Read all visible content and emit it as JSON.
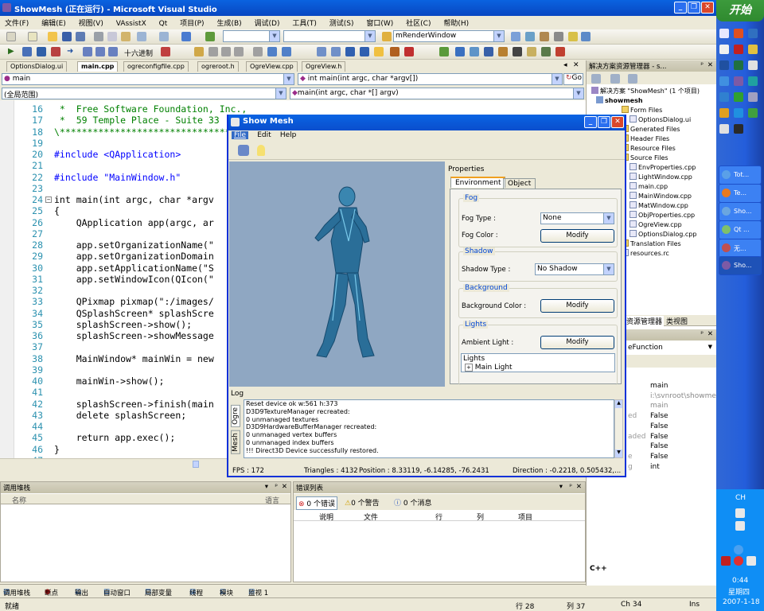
{
  "vs": {
    "title": "ShowMesh (正在运行) - Microsoft Visual Studio",
    "menu": [
      "文件(F)",
      "编辑(E)",
      "视图(V)",
      "VAssistX",
      "Qt",
      "项目(P)",
      "生成(B)",
      "调试(D)",
      "工具(T)",
      "测试(S)",
      "窗口(W)",
      "社区(C)",
      "帮助(H)"
    ],
    "toolbar2_hex_label": "十六进制",
    "target_combo": "mRenderWindow",
    "doc_tabs": [
      "OptionsDialog.ui",
      "main.cpp",
      "ogreconfigfile.cpp",
      "ogreroot.h",
      "OgreView.cpp",
      "OgreView.h"
    ],
    "scope_combo_left": "main",
    "scope_combo_right": "int main(int argc, char *argv[])",
    "go_label": "Go",
    "scope_combo_global": "(全局范围)",
    "scope_combo_func": "main(int argc, char *[] argv)"
  },
  "code": [
    {
      "ln": "16",
      "text": " *  Free Software Foundation, Inc.,",
      "cls": "cm"
    },
    {
      "ln": "17",
      "text": " *  59 Temple Place - Suite 33",
      "cls": "cm"
    },
    {
      "ln": "18",
      "text": "\\*******************************",
      "cls": "cm"
    },
    {
      "ln": "19",
      "text": "",
      "cls": ""
    },
    {
      "ln": "20",
      "text": "#include <QApplication>",
      "cls": "kw"
    },
    {
      "ln": "21",
      "text": "",
      "cls": ""
    },
    {
      "ln": "22",
      "text": "#include \"MainWindow.h\"",
      "cls": "kw"
    },
    {
      "ln": "23",
      "text": "",
      "cls": ""
    },
    {
      "ln": "24",
      "text": "int main(int argc, char *argv",
      "cls": ""
    },
    {
      "ln": "25",
      "text": "{",
      "cls": ""
    },
    {
      "ln": "26",
      "text": "    QApplication app(argc, ar",
      "cls": ""
    },
    {
      "ln": "27",
      "text": "",
      "cls": ""
    },
    {
      "ln": "28",
      "text": "    app.setOrganizationName(\"",
      "cls": ""
    },
    {
      "ln": "29",
      "text": "    app.setOrganizationDomain",
      "cls": ""
    },
    {
      "ln": "30",
      "text": "    app.setApplicationName(\"S",
      "cls": ""
    },
    {
      "ln": "31",
      "text": "    app.setWindowIcon(QIcon(\"",
      "cls": ""
    },
    {
      "ln": "32",
      "text": "",
      "cls": ""
    },
    {
      "ln": "33",
      "text": "    QPixmap pixmap(\":/images/",
      "cls": ""
    },
    {
      "ln": "34",
      "text": "    QSplashScreen* splashScre",
      "cls": ""
    },
    {
      "ln": "35",
      "text": "    splashScreen->show();",
      "cls": ""
    },
    {
      "ln": "36",
      "text": "    splashScreen->showMessage",
      "cls": ""
    },
    {
      "ln": "37",
      "text": "",
      "cls": ""
    },
    {
      "ln": "38",
      "text": "    MainWindow* mainWin = new",
      "cls": ""
    },
    {
      "ln": "39",
      "text": "",
      "cls": ""
    },
    {
      "ln": "40",
      "text": "    mainWin->show();",
      "cls": ""
    },
    {
      "ln": "41",
      "text": "",
      "cls": ""
    },
    {
      "ln": "42",
      "text": "    splashScreen->finish(main",
      "cls": ""
    },
    {
      "ln": "43",
      "text": "    delete splashScreen;",
      "cls": ""
    },
    {
      "ln": "44",
      "text": "",
      "cls": ""
    },
    {
      "ln": "45",
      "text": "    return app.exec();",
      "cls": ""
    },
    {
      "ln": "46",
      "text": "}",
      "cls": ""
    },
    {
      "ln": "47",
      "text": "",
      "cls": ""
    }
  ],
  "solution": {
    "title": "解决方案资源管理器 - s...",
    "root": "解决方案 \"ShowMesh\" (1 个项目)",
    "project": "showmesh",
    "items": [
      {
        "label": "Form Files",
        "indent": 2,
        "folder": true
      },
      {
        "label": "OptionsDialog.ui",
        "indent": 3,
        "folder": false
      },
      {
        "label": "Generated Files",
        "indent": 2,
        "folder": true
      },
      {
        "label": "Header Files",
        "indent": 2,
        "folder": true
      },
      {
        "label": "Resource Files",
        "indent": 2,
        "folder": true
      },
      {
        "label": "Source Files",
        "indent": 2,
        "folder": true
      },
      {
        "label": "EnvProperties.cpp",
        "indent": 3,
        "folder": false
      },
      {
        "label": "LightWindow.cpp",
        "indent": 3,
        "folder": false
      },
      {
        "label": "main.cpp",
        "indent": 3,
        "folder": false
      },
      {
        "label": "MainWindow.cpp",
        "indent": 3,
        "folder": false
      },
      {
        "label": "MatWindow.cpp",
        "indent": 3,
        "folder": false
      },
      {
        "label": "ObjProperties.cpp",
        "indent": 3,
        "folder": false
      },
      {
        "label": "OgreView.cpp",
        "indent": 3,
        "folder": false
      },
      {
        "label": "OptionsDialog.cpp",
        "indent": 3,
        "folder": false
      },
      {
        "label": "Translation Files",
        "indent": 2,
        "folder": true
      },
      {
        "label": "resources.rc",
        "indent": 2,
        "folder": false
      }
    ],
    "tab1": "资源管理器",
    "tab2": "类视图"
  },
  "properties_lower": {
    "combo": "eFunction",
    "rows": [
      {
        "name": "",
        "value": "main"
      },
      {
        "name": "",
        "value": "i:\\svnroot\\showmes"
      },
      {
        "name": "",
        "value": "main"
      },
      {
        "name": "ed",
        "value": "False"
      },
      {
        "name": "",
        "value": "False"
      },
      {
        "name": "aded",
        "value": "False"
      },
      {
        "name": "",
        "value": "False"
      },
      {
        "name": "e",
        "value": "False"
      },
      {
        "name": "g",
        "value": "int"
      }
    ],
    "lang": "C++"
  },
  "showmesh": {
    "title": "Show Mesh",
    "menu": [
      "File",
      "Edit",
      "Help"
    ],
    "props_title": "Properties",
    "tabs": [
      "Environment",
      "Object"
    ],
    "fog": {
      "title": "Fog",
      "type_label": "Fog Type :",
      "type_value": "None",
      "color_label": "Fog Color :",
      "btn": "Modify"
    },
    "shadow": {
      "title": "Shadow",
      "type_label": "Shadow Type :",
      "type_value": "No Shadow"
    },
    "background": {
      "title": "Background",
      "color_label": "Background Color :",
      "btn": "Modify"
    },
    "lights": {
      "title": "Lights",
      "ambient_label": "Ambient Light :",
      "btn": "Modify",
      "list_header": "Lights",
      "list_item": "Main Light"
    },
    "log_title": "Log",
    "side_tabs": [
      "Ogre",
      "Mesh"
    ],
    "log_lines": [
      "Reset device ok w:561 h:373",
      "D3D9TextureManager recreated:",
      "0 unmanaged textures",
      "D3D9HardwareBufferManager recreated:",
      "0 unmanaged vertex buffers",
      "0 unmanaged index buffers",
      "!!! Direct3D Device successfully restored."
    ],
    "status": {
      "fps": "FPS : 172",
      "triangles": "Triangles : 4132",
      "position": "Position : 8.33119, -6.14285, -76.2431",
      "direction": "Direction : -0.2218, 0.505432,..."
    }
  },
  "callstack": {
    "title": "调用堆栈",
    "col_name": "名称",
    "col_lang": "语言"
  },
  "errorlist": {
    "title": "错误列表",
    "errors": "0 个错误",
    "warnings": "0 个警告",
    "messages": "0 个消息",
    "cols": [
      "说明",
      "文件",
      "行",
      "列",
      "项目"
    ]
  },
  "bottom_tabs": [
    "调用堆栈",
    "断点",
    "输出",
    "自动窗口",
    "局部变量",
    "线程",
    "模块",
    "监视 1"
  ],
  "status": {
    "ready": "就绪",
    "line": "行 28",
    "col": "列 37",
    "ch": "Ch 34",
    "ins": "Ins"
  },
  "taskbar": {
    "start": "开始",
    "buttons": [
      {
        "label": "Tot...",
        "color": "#5aa0e8"
      },
      {
        "label": "Te...",
        "color": "#e87a20"
      },
      {
        "label": "Sho...",
        "color": "#6aa6e0"
      },
      {
        "label": "Qt ...",
        "color": "#7fc06a"
      },
      {
        "label": "无...",
        "color": "#c05050"
      },
      {
        "label": "Sho...",
        "color": "#7d5aa5"
      }
    ],
    "lang": "CH",
    "time": "0:44",
    "weekday": "星期四",
    "date": "2007-1-18"
  },
  "colors": {
    "accent": "#0a4ecd",
    "taskbar": "#245edb",
    "panel": "#ece9d8"
  }
}
